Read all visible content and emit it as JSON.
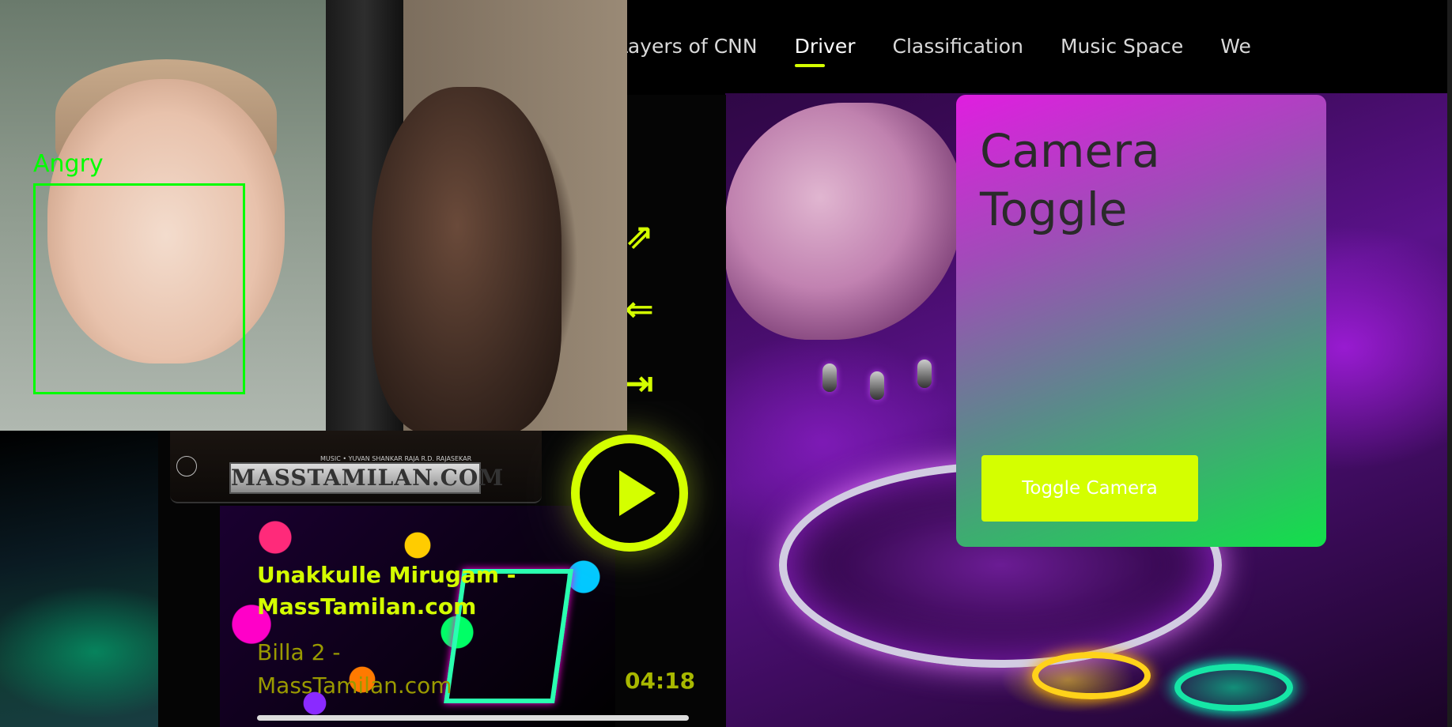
{
  "nav": {
    "items": [
      {
        "label": "Layers of CNN"
      },
      {
        "label": "Driver"
      },
      {
        "label": "Classification"
      },
      {
        "label": "Music Space"
      },
      {
        "label": "We"
      }
    ],
    "active": "Driver"
  },
  "webcam": {
    "emotion_label": "Angry",
    "box_color": "#00ff00"
  },
  "player": {
    "banner_watermark": "MASSTAMILAN.COM",
    "banner_credits": "MUSIC • YUVAN SHANKAR RAJA  R.D. RAJASEKAR\nMUTHUKUMAR\nGEORGE PIUS",
    "song_title": "Unakkulle Mirugam - MassTamilan.com",
    "album": "Billa 2 - MassTamilan.com",
    "time": "04:18",
    "icons": {
      "share": "external-link-icon",
      "back": "arrow-left-icon",
      "next": "skip-next-icon",
      "play": "play-icon"
    },
    "accent_color": "#d4ff00"
  },
  "camera_card": {
    "title": "Camera Toggle",
    "button_label": "Toggle Camera"
  }
}
